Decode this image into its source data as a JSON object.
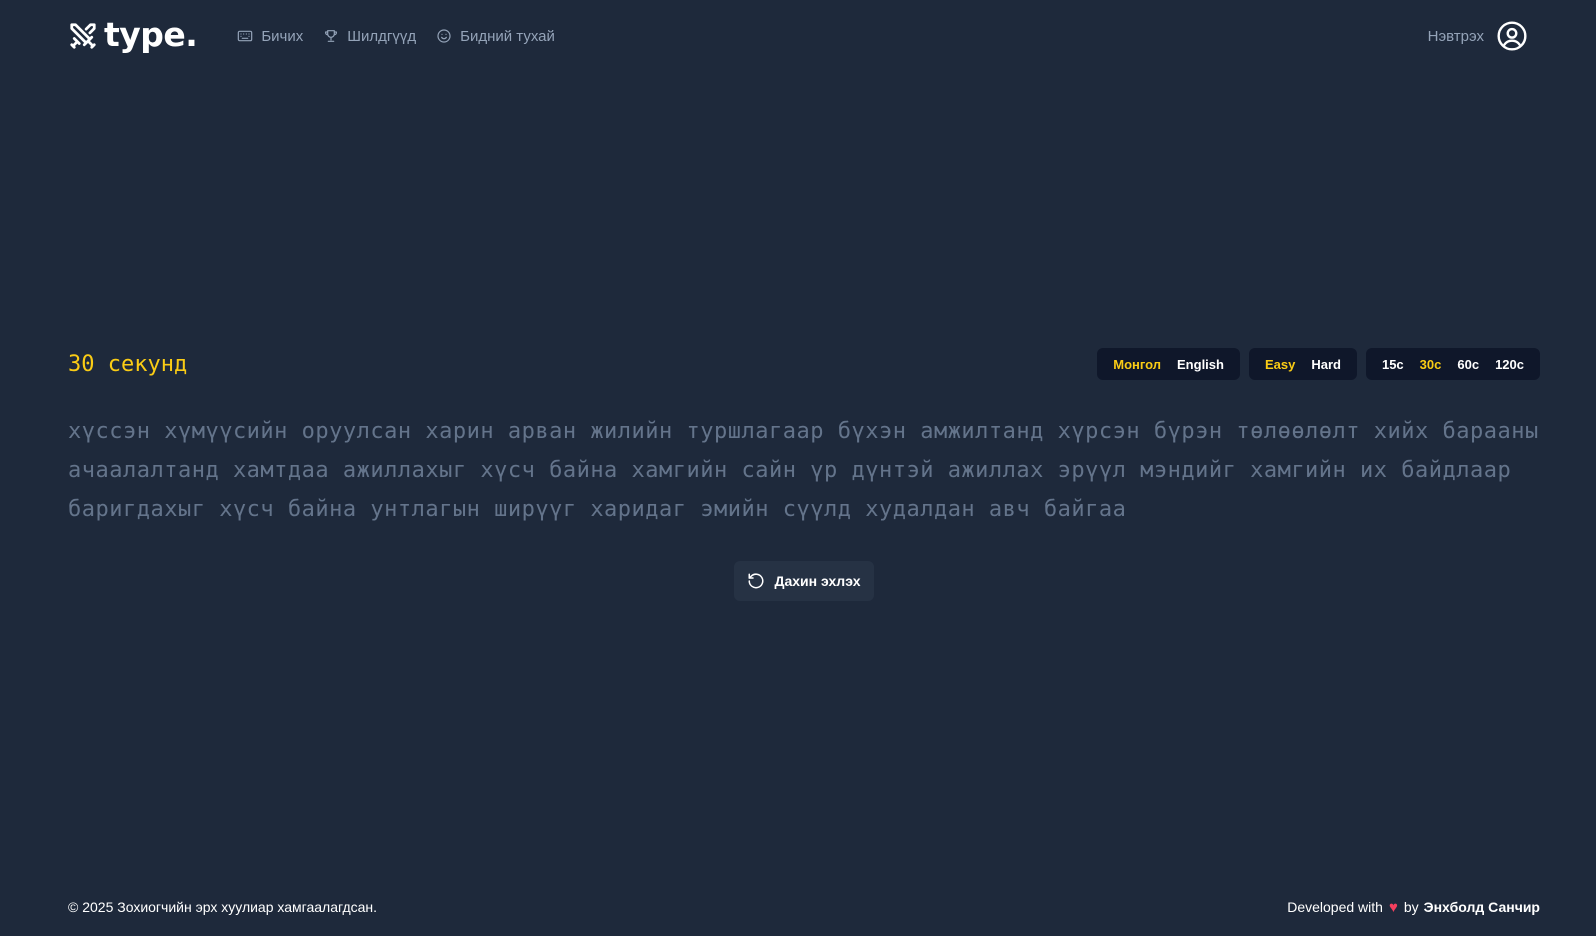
{
  "header": {
    "logo_text": "type.",
    "nav": [
      {
        "label": "Бичих",
        "icon": "keyboard-icon"
      },
      {
        "label": "Шилдгүүд",
        "icon": "trophy-icon"
      },
      {
        "label": "Бидний тухай",
        "icon": "smile-icon"
      }
    ],
    "login_label": "Нэвтрэх"
  },
  "test": {
    "timer_label": "30 секунд",
    "languages": [
      {
        "label": "Монгол",
        "active": true
      },
      {
        "label": "English",
        "active": false
      }
    ],
    "difficulties": [
      {
        "label": "Easy",
        "active": true
      },
      {
        "label": "Hard",
        "active": false
      }
    ],
    "durations": [
      {
        "label": "15с",
        "active": false
      },
      {
        "label": "30с",
        "active": true
      },
      {
        "label": "60с",
        "active": false
      },
      {
        "label": "120с",
        "active": false
      }
    ],
    "words_text": "хүссэн хүмүүсийн оруулсан харин арван жилийн туршлагаар бүхэн амжилтанд хүрсэн бүрэн төлөөлөлт хийх барааны ачаалалтанд хамтдаа ажиллахыг хүсч байна хамгийн сайн үр дүнтэй ажиллах эрүүл мэндийг хамгийн их байдлаар баригдахыг хүсч байна унтлагын ширүүг харидаг эмийн сүүлд худалдан авч байгаа",
    "restart_label": "Дахин эхлэх"
  },
  "footer": {
    "copyright": "© 2025 Зохиогчийн эрх хуулиар хамгаалагдсан.",
    "developed_with": "Developed with",
    "by": "by",
    "author": "Энхболд Санчир"
  },
  "colors": {
    "background": "#1e293b",
    "accent": "#facc15",
    "muted_text": "#64748b",
    "heart": "#f43f5e"
  }
}
